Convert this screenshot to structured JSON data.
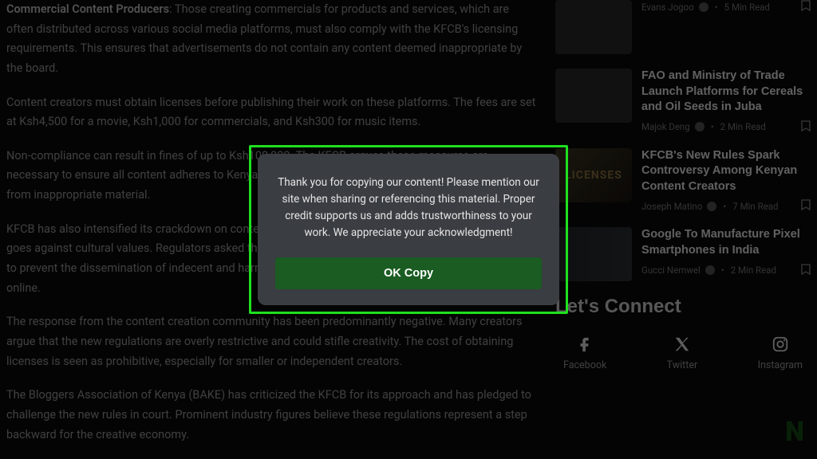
{
  "article": {
    "p1_strong": "Commercial Content Producers",
    "p1_rest": ": Those creating commercials for products and services, which are often distributed across various social media platforms, must also comply with the KFCB's licensing requirements. This ensures that advertisements do not contain any content deemed inappropriate by the board.",
    "p2": "Content creators must obtain licenses before publishing their work on these platforms. The fees are set at Ksh4,500 for a movie, Ksh1,000 for commercials, and Ksh300 for music items.",
    "p3": "Non-compliance can result in fines of up to Ksh100,000. The KFCB argues these measures are necessary to ensure all content adheres to Kenya's cultural values and standards to safeguard minors from inappropriate material.",
    "p4": "KFCB has also intensified its crackdown on content creation platforms like TikTok and content that goes against cultural values. Regulators asked the platform to remove specific videos. The board aims to prevent the dissemination of indecent and harmful content, emphasizing the protection of children online.",
    "p5": "The response from the content creation community has been predominantly negative. Many creators argue that the new regulations are overly restrictive and could stifle creativity. The cost of obtaining licenses is seen as prohibitive, especially for smaller or independent creators.",
    "p6": "The Bloggers Association of Kenya (BAKE) has criticized the KFCB for its approach and has pledged to challenge the new rules in court. Prominent industry figures believe these regulations represent a step backward for the creative economy."
  },
  "sidebar": {
    "items": [
      {
        "title": "",
        "author": "Evans Jogoo",
        "read": "5 Min Read",
        "thumb": ""
      },
      {
        "title": "FAO and Ministry of Trade Launch Platforms for Cereals and Oil Seeds in Juba",
        "author": "Majok Deng",
        "read": "2 Min Read",
        "thumb": ""
      },
      {
        "title": "KFCB's New Rules Spark Controversy Among Kenyan Content Creators",
        "author": "Joseph Matino",
        "read": "7 Min Read",
        "thumb": "LICENSES"
      },
      {
        "title": "Google To Manufacture Pixel Smartphones in India",
        "author": "Gucci Nemwel",
        "read": "2 Min Read",
        "thumb": ""
      }
    ]
  },
  "connect": {
    "heading": "Let's Connect",
    "facebook": "Facebook",
    "twitter": "Twitter",
    "instagram": "Instagram"
  },
  "modal": {
    "text": "Thank you for copying our content! Please mention our site when sharing or referencing this material. Proper credit supports us and adds trustworthiness to your work. We appreciate your acknowledgment!",
    "button": "OK Copy"
  },
  "logo": "N"
}
